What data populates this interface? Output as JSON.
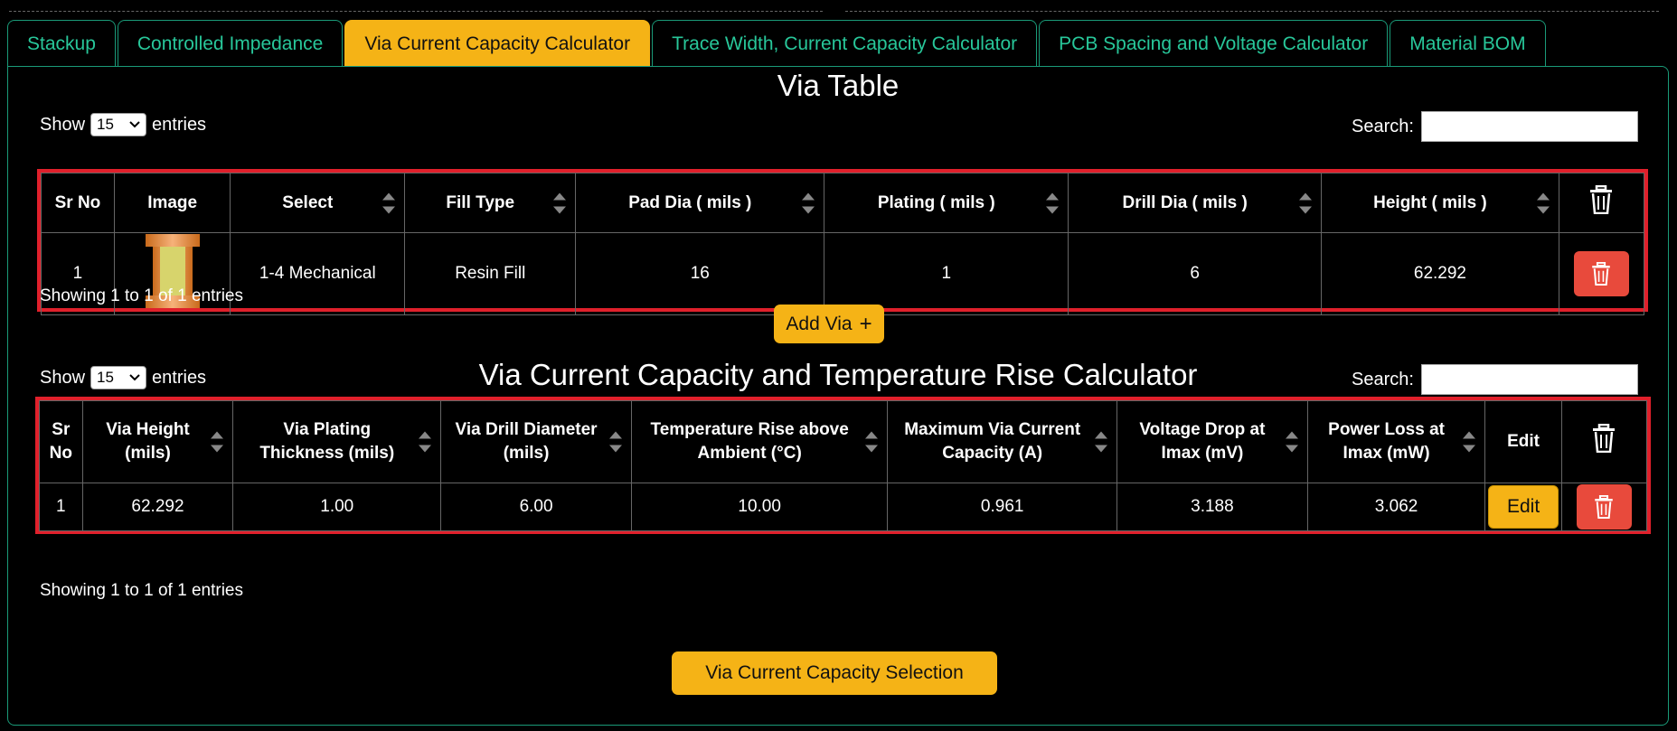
{
  "tabs": [
    {
      "label": "Stackup",
      "active": false
    },
    {
      "label": "Controlled Impedance",
      "active": false
    },
    {
      "label": "Via Current Capacity Calculator",
      "active": true
    },
    {
      "label": "Trace Width, Current Capacity Calculator",
      "active": false
    },
    {
      "label": "PCB Spacing and Voltage Calculator",
      "active": false
    },
    {
      "label": "Material BOM",
      "active": false
    }
  ],
  "via_table": {
    "title": "Via Table",
    "show_label": "Show",
    "entries_label": "entries",
    "page_size": "15",
    "search_label": "Search:",
    "columns": [
      "Sr No",
      "Image",
      "Select",
      "Fill Type",
      "Pad Dia ( mils )",
      "Plating ( mils )",
      "Drill Dia ( mils )",
      "Height ( mils )"
    ],
    "rows": [
      {
        "sr": "1",
        "select": "1-4 Mechanical",
        "fill": "Resin Fill",
        "pad": "16",
        "plating": "1",
        "drill": "6",
        "height": "62.292"
      }
    ],
    "showing": "Showing 1 to 1 of 1 entries",
    "add_button": "Add Via",
    "add_icon": "+"
  },
  "calc_table": {
    "title": "Via Current Capacity and Temperature Rise Calculator",
    "show_label": "Show",
    "entries_label": "entries",
    "page_size": "15",
    "search_label": "Search:",
    "columns": [
      "Sr No",
      "Via Height (mils)",
      "Via Plating Thickness (mils)",
      "Via Drill Diameter (mils)",
      "Temperature Rise above Ambient (°C)",
      "Maximum Via Current Capacity (A)",
      "Voltage Drop at Imax (mV)",
      "Power Loss at Imax (mW)",
      "Edit"
    ],
    "rows": [
      {
        "sr": "1",
        "height": "62.292",
        "plating": "1.00",
        "drill": "6.00",
        "temp": "10.00",
        "imax": "0.961",
        "vdrop": "3.188",
        "ploss": "3.062",
        "edit": "Edit"
      }
    ],
    "showing": "Showing 1 to 1 of 1 entries",
    "selection_button": "Via Current Capacity Selection"
  },
  "colors": {
    "accent": "#f5b316",
    "tab_text": "#28c79a",
    "danger": "#e84a3c",
    "frame": "#e0202b"
  }
}
